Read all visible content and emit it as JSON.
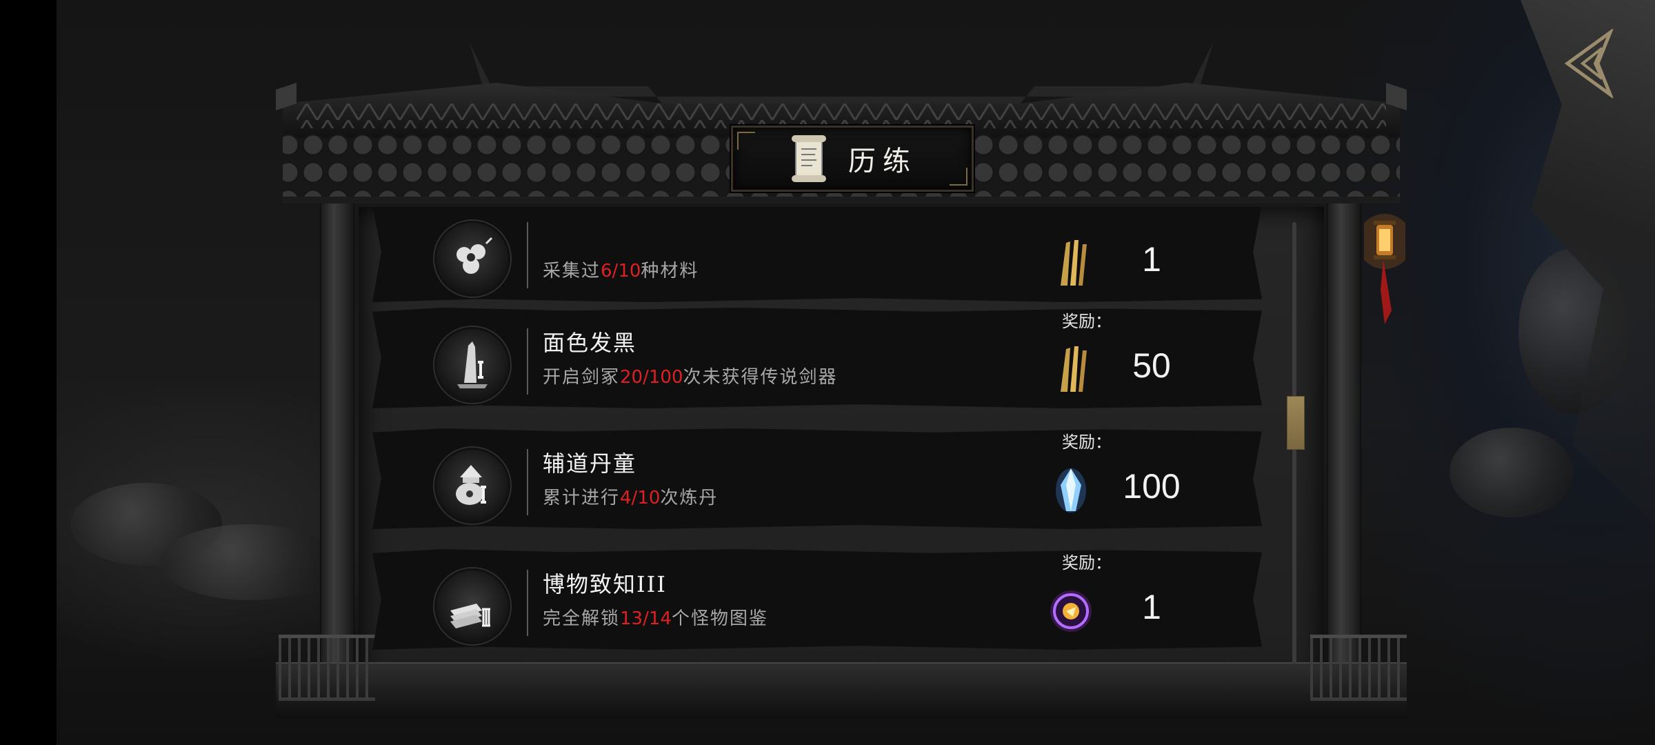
{
  "header": {
    "title": "历练",
    "title_icon": "scroll-icon",
    "back_icon": "back-arrow-icon"
  },
  "colors": {
    "progress": "#e02020",
    "scroll_thumb": "#9c8757",
    "reward_gold": "#c9a04a"
  },
  "quests": [
    {
      "title": "",
      "desc_prefix": "采集过",
      "progress": "6/10",
      "desc_suffix": "种材料",
      "icon": "flower-badge-icon",
      "reward_label": "",
      "reward_icon": "golden-swords-icon",
      "reward_value": "1"
    },
    {
      "title": "面色发黑",
      "desc_prefix": "开启剑冢",
      "progress": "20/100",
      "desc_suffix": "次未获得传说剑器",
      "icon": "sword-tomb-badge-icon",
      "reward_label": "奖励：",
      "reward_icon": "golden-swords-icon",
      "reward_value": "50"
    },
    {
      "title": "辅道丹童",
      "desc_prefix": "累计进行",
      "progress": "4/10",
      "desc_suffix": "次炼丹",
      "icon": "alchemy-furnace-badge-icon",
      "reward_label": "奖励：",
      "reward_icon": "blue-crystal-icon",
      "reward_value": "100"
    },
    {
      "title": "博物致知III",
      "desc_prefix": "完全解锁",
      "progress": "13/14",
      "desc_suffix": "个怪物图鉴",
      "icon": "books-badge-icon",
      "reward_label": "奖励：",
      "reward_icon": "purple-orb-icon",
      "reward_value": "1"
    }
  ]
}
